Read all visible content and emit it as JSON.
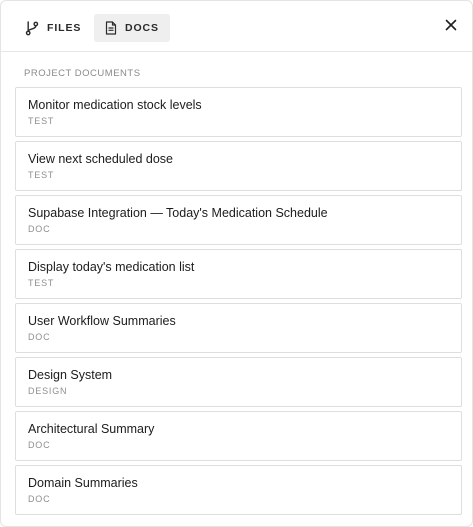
{
  "tabs": {
    "files_label": "FILES",
    "docs_label": "DOCS"
  },
  "section": {
    "label": "PROJECT DOCUMENTS"
  },
  "documents": [
    {
      "title": "Monitor medication stock levels",
      "type": "TEST"
    },
    {
      "title": "View next scheduled dose",
      "type": "TEST"
    },
    {
      "title": "Supabase Integration — Today's Medication Schedule",
      "type": "DOC"
    },
    {
      "title": "Display today's medication list",
      "type": "TEST"
    },
    {
      "title": "User Workflow Summaries",
      "type": "DOC"
    },
    {
      "title": "Design System",
      "type": "DESIGN"
    },
    {
      "title": "Architectural Summary",
      "type": "DOC"
    },
    {
      "title": "Domain Summaries",
      "type": "DOC"
    }
  ],
  "icons": {
    "files": "git-branch-icon",
    "docs": "document-icon",
    "close": "close-icon"
  },
  "colors": {
    "active_tab_bg": "#efefef",
    "border": "#dedede",
    "muted_text": "#8a8a8a"
  }
}
